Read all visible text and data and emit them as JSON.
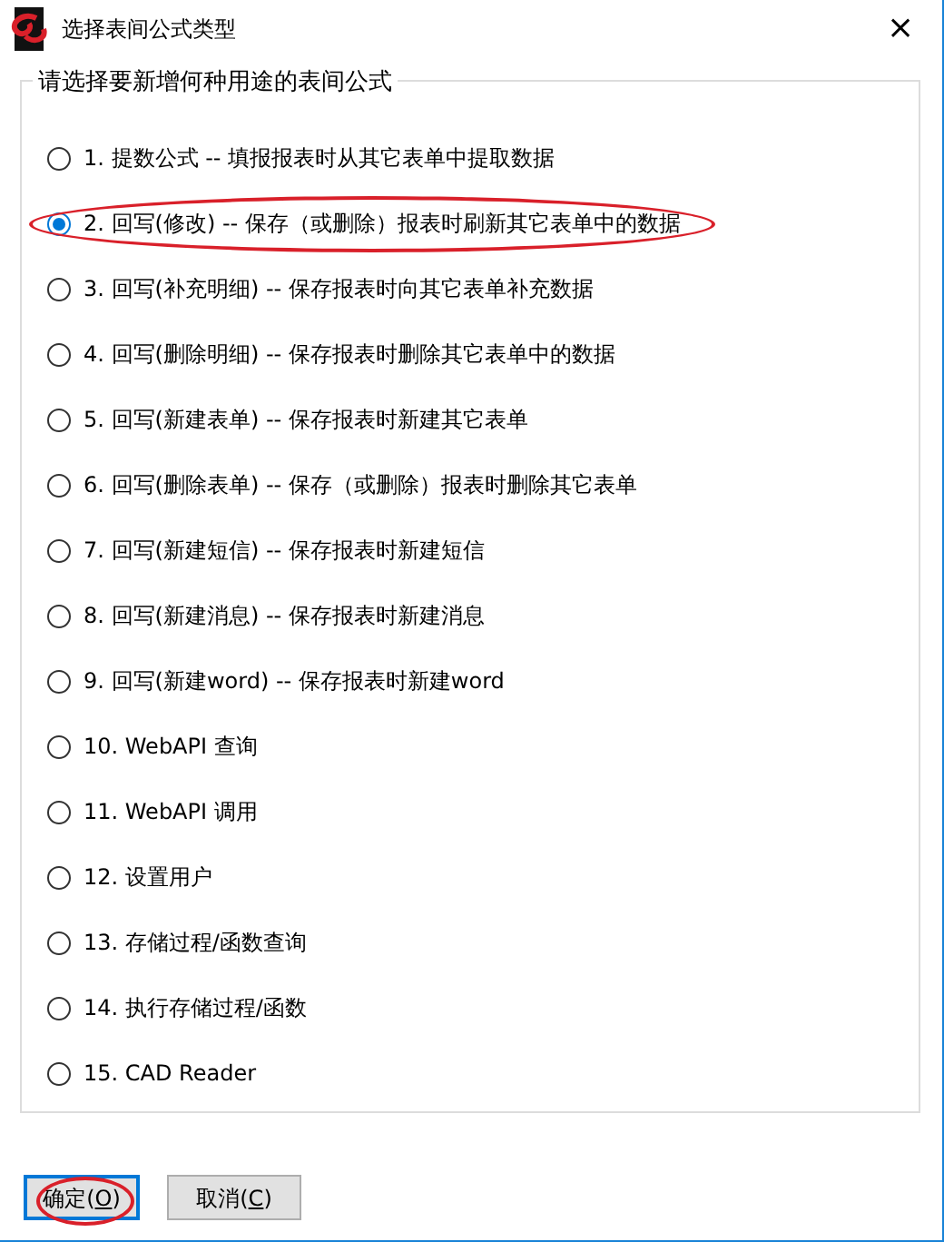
{
  "window": {
    "title": "选择表间公式类型",
    "close": "×"
  },
  "group": {
    "title": "请选择要新增何种用途的表间公式",
    "options": [
      {
        "label": "1. 提数公式 -- 填报报表时从其它表单中提取数据",
        "selected": false,
        "circled": false
      },
      {
        "label": "2. 回写(修改) -- 保存（或删除）报表时刷新其它表单中的数据",
        "selected": true,
        "circled": true
      },
      {
        "label": "3. 回写(补充明细) -- 保存报表时向其它表单补充数据",
        "selected": false,
        "circled": false
      },
      {
        "label": "4. 回写(删除明细) -- 保存报表时删除其它表单中的数据",
        "selected": false,
        "circled": false
      },
      {
        "label": "5. 回写(新建表单) -- 保存报表时新建其它表单",
        "selected": false,
        "circled": false
      },
      {
        "label": "6. 回写(删除表单) -- 保存（或删除）报表时删除其它表单",
        "selected": false,
        "circled": false
      },
      {
        "label": "7. 回写(新建短信) -- 保存报表时新建短信",
        "selected": false,
        "circled": false
      },
      {
        "label": "8. 回写(新建消息) -- 保存报表时新建消息",
        "selected": false,
        "circled": false
      },
      {
        "label": "9. 回写(新建word) -- 保存报表时新建word",
        "selected": false,
        "circled": false
      },
      {
        "label": "10. WebAPI 查询",
        "selected": false,
        "circled": false
      },
      {
        "label": "11. WebAPI 调用",
        "selected": false,
        "circled": false
      },
      {
        "label": "12. 设置用户",
        "selected": false,
        "circled": false
      },
      {
        "label": "13. 存储过程/函数查询",
        "selected": false,
        "circled": false
      },
      {
        "label": "14. 执行存储过程/函数",
        "selected": false,
        "circled": false
      },
      {
        "label": "15. CAD Reader",
        "selected": false,
        "circled": false
      }
    ]
  },
  "buttons": [
    {
      "before": "确定(",
      "key": "O",
      "after": ")",
      "default": true,
      "circled": true
    },
    {
      "before": "取消(",
      "key": "C",
      "after": ")",
      "default": false,
      "circled": false
    }
  ]
}
